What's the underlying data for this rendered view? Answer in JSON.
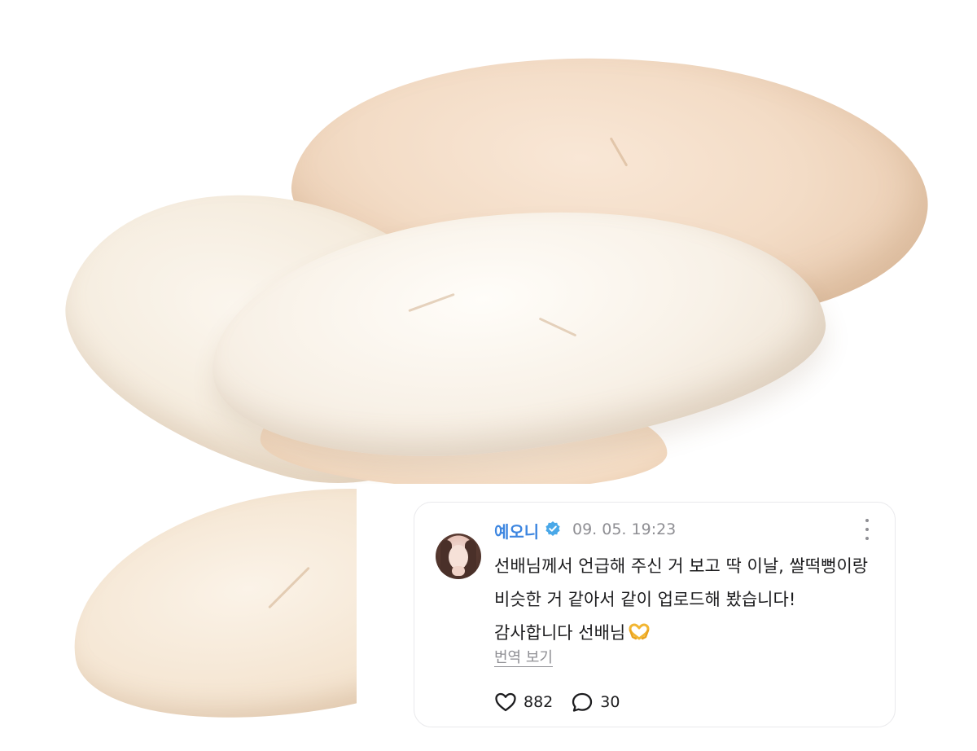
{
  "post": {
    "author": "예오니",
    "timestamp": "09. 05. 19:23",
    "lines": [
      "선배님께서 언급해 주신 거 보고 딱 이날, 쌀떡뻥이랑",
      "비슷한 거 같아서 같이 업로드해 봤습니다!",
      "감사합니다 선배님"
    ],
    "translate_label": "번역 보기",
    "likes": "882",
    "comments": "30",
    "icons": {
      "verified": "verified-badge-icon",
      "more": "more-vertical-icon",
      "like": "heart-outline-icon",
      "comment": "speech-bubble-icon",
      "emoji": "heart-hands-emoji"
    },
    "colors": {
      "username": "#3d86e0",
      "verified_badge": "#4aa8e8",
      "muted_text": "#8e8e93",
      "body_text": "#1c1c1e"
    }
  }
}
